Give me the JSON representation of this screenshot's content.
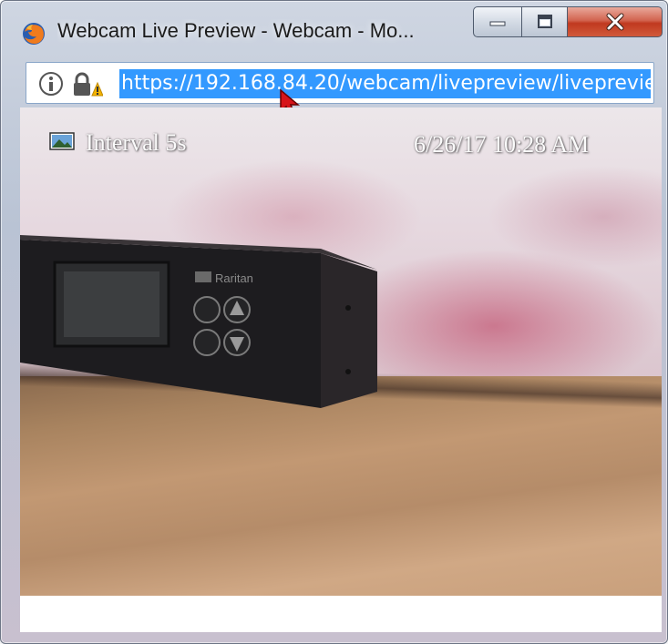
{
  "window": {
    "title": "Webcam Live Preview - Webcam - Mo...",
    "app_icon": "firefox-icon",
    "controls": {
      "minimize_icon": "minimize-icon",
      "maximize_icon": "maximize-icon",
      "close_icon": "close-icon"
    }
  },
  "addressbar": {
    "info_icon": "info-icon",
    "lock_icon": "lock-warning-icon",
    "url": "https://192.168.84.20/webcam/livepreview/livepreview",
    "selected": true
  },
  "preview": {
    "interval_label": "Interval 5s",
    "timestamp": "6/26/17 10:28 AM",
    "image_icon": "image-icon"
  },
  "colors": {
    "selection": "#3399ff",
    "close_button": "#c0391f",
    "address_border": "#8aa6c9"
  }
}
